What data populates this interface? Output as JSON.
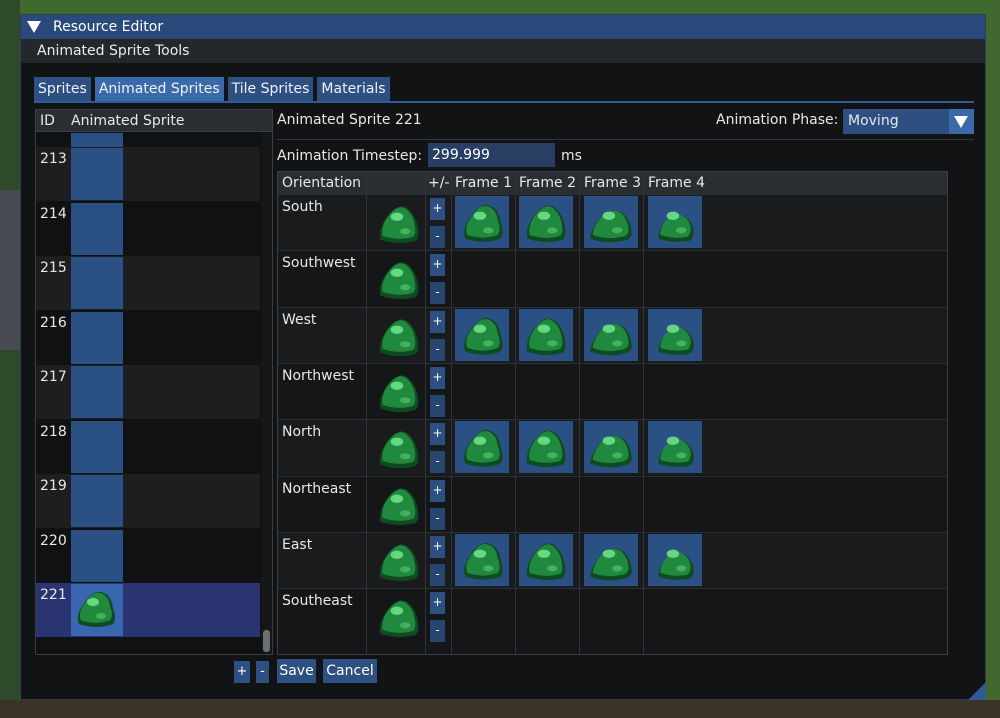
{
  "window": {
    "title": "Resource Editor",
    "section": "Animated Sprite Tools"
  },
  "tabs": [
    {
      "label": "Sprites",
      "active": false
    },
    {
      "label": "Animated Sprites",
      "active": true
    },
    {
      "label": "Tile Sprites",
      "active": false
    },
    {
      "label": "Materials",
      "active": false
    }
  ],
  "list": {
    "header_id": "ID",
    "header_sprite": "Animated Sprite",
    "rows": [
      {
        "id": ""
      },
      {
        "id": "213"
      },
      {
        "id": "214"
      },
      {
        "id": "215"
      },
      {
        "id": "216"
      },
      {
        "id": "217"
      },
      {
        "id": "218"
      },
      {
        "id": "219"
      },
      {
        "id": "220"
      },
      {
        "id": "221",
        "selected": true
      }
    ],
    "add_label": "+",
    "remove_label": "-"
  },
  "editor": {
    "sprite_title": "Animated Sprite 221",
    "phase_label": "Animation Phase:",
    "phase_value": "Moving",
    "timestep_label": "Animation Timestep:",
    "timestep_value": "299.999",
    "timestep_unit": "ms"
  },
  "table": {
    "headers": {
      "orientation": "Orientation",
      "plusminus": "+/-",
      "frame1": "Frame 1",
      "frame2": "Frame 2",
      "frame3": "Frame 3",
      "frame4": "Frame 4"
    },
    "rows": [
      {
        "name": "South",
        "frames": 4
      },
      {
        "name": "Southwest",
        "frames": 0
      },
      {
        "name": "West",
        "frames": 4
      },
      {
        "name": "Northwest",
        "frames": 0
      },
      {
        "name": "North",
        "frames": 4
      },
      {
        "name": "Northeast",
        "frames": 0
      },
      {
        "name": "East",
        "frames": 4
      },
      {
        "name": "Southeast",
        "frames": 0
      }
    ],
    "plus_label": "+",
    "minus_label": "-"
  },
  "actions": {
    "save_label": "Save",
    "cancel_label": "Cancel"
  },
  "colors": {
    "title_bar": "#2b4a7c",
    "tab": "#2d4f82",
    "tab_active": "#3b6aab",
    "thumb": "#2b5184",
    "selected_row": "#2a3470",
    "slime_dark": "#0f4a22",
    "slime_mid": "#1f8a3e",
    "slime_light": "#6fe08a"
  },
  "icons": {
    "slime": "green-slime-sprite-icon",
    "collapse": "triangle-down-icon",
    "dropdown": "chevron-down-icon"
  }
}
